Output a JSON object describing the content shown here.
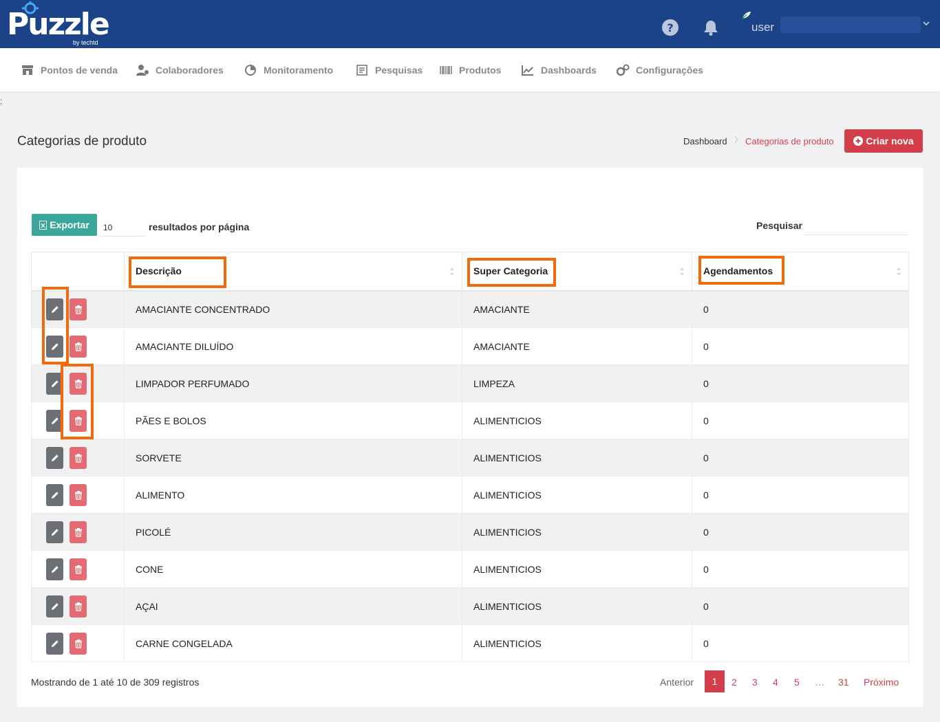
{
  "header": {
    "logo_text": "Puzzle",
    "logo_sub": "by techtd",
    "user_name": "user"
  },
  "nav": {
    "items": [
      {
        "label": "Pontos de venda",
        "icon": "store-icon"
      },
      {
        "label": "Colaboradores",
        "icon": "users-icon"
      },
      {
        "label": "Monitoramento",
        "icon": "monitor-icon"
      },
      {
        "label": "Pesquisas",
        "icon": "survey-icon"
      },
      {
        "label": "Produtos",
        "icon": "barcode-icon"
      },
      {
        "label": "Dashboards",
        "icon": "chart-icon"
      },
      {
        "label": "Configurações",
        "icon": "gears-icon"
      }
    ]
  },
  "stray_char": ";",
  "page": {
    "title": "Categorias de produto",
    "breadcrumb": [
      "Dashboard",
      "Categorias de produto"
    ],
    "new_button": "Criar nova"
  },
  "toolbar": {
    "export_label": "Exportar",
    "page_size": "10",
    "per_page_label": "resultados por página",
    "search_label": "Pesquisar",
    "search_value": ""
  },
  "table": {
    "columns": [
      "Descrição",
      "Super Categoria",
      "Agendamentos"
    ],
    "rows": [
      {
        "desc": "AMACIANTE CONCENTRADO",
        "super": "AMACIANTE",
        "count": "0"
      },
      {
        "desc": "AMACIANTE DILUÍDO",
        "super": "AMACIANTE",
        "count": "0"
      },
      {
        "desc": "LIMPADOR PERFUMADO",
        "super": "LIMPEZA",
        "count": "0"
      },
      {
        "desc": "PÃES E BOLOS",
        "super": "ALIMENTICIOS",
        "count": "0"
      },
      {
        "desc": "SORVETE",
        "super": "ALIMENTICIOS",
        "count": "0"
      },
      {
        "desc": "ALIMENTO",
        "super": "ALIMENTICIOS",
        "count": "0"
      },
      {
        "desc": "PICOLÉ",
        "super": "ALIMENTICIOS",
        "count": "0"
      },
      {
        "desc": "CONE",
        "super": "ALIMENTICIOS",
        "count": "0"
      },
      {
        "desc": "AÇAI",
        "super": "ALIMENTICIOS",
        "count": "0"
      },
      {
        "desc": "CARNE CONGELADA",
        "super": "ALIMENTICIOS",
        "count": "0"
      }
    ]
  },
  "footer": {
    "info": "Mostrando de 1 até 10 de 309 registros",
    "prev": "Anterior",
    "pages": [
      "1",
      "2",
      "3",
      "4",
      "5",
      "…",
      "31"
    ],
    "next": "Próximo"
  },
  "colors": {
    "header_bg": "#1c4288",
    "accent_red": "#d23e4a",
    "export_green": "#3aa79b",
    "highlight_orange": "#f36a0b"
  }
}
